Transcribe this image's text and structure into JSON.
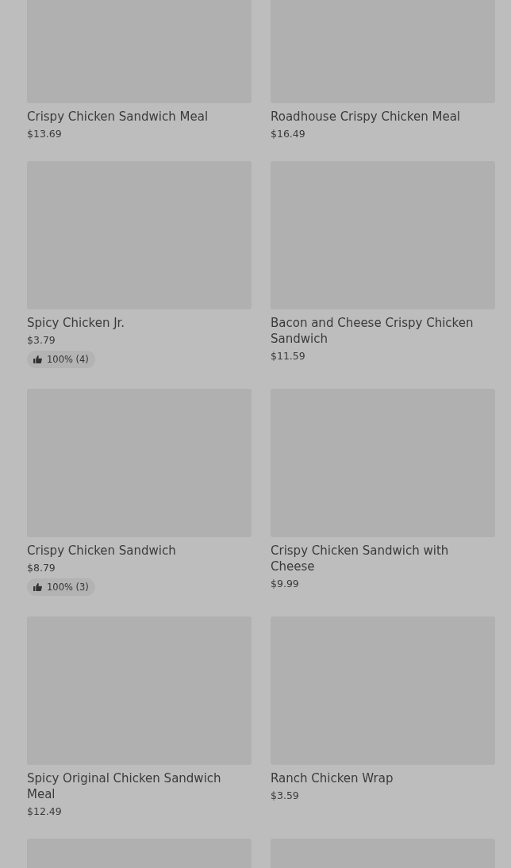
{
  "items": [
    {
      "kind": "product",
      "name": "Crispy Chicken Sandwich Meal",
      "price": "$13.69"
    },
    {
      "kind": "product",
      "name": "Roadhouse Crispy Chicken Meal",
      "price": "$16.49"
    },
    {
      "kind": "product",
      "name": "Spicy Chicken Jr.",
      "price": "$3.79",
      "rating": "100% (4)"
    },
    {
      "kind": "product",
      "name": "Bacon and Cheese Crispy Chicken Sandwich",
      "price": "$11.59"
    },
    {
      "kind": "product",
      "name": "Crispy Chicken Sandwich",
      "price": "$8.79",
      "rating": "100% (3)"
    },
    {
      "kind": "product",
      "name": "Crispy Chicken Sandwich with Cheese",
      "price": "$9.99"
    },
    {
      "kind": "product",
      "name": "Spicy Original Chicken Sandwich Meal",
      "price": "$12.49"
    },
    {
      "kind": "product",
      "name": "Ranch Chicken Wrap",
      "price": "$3.59"
    },
    {
      "kind": "picture"
    },
    {
      "kind": "picture"
    }
  ]
}
